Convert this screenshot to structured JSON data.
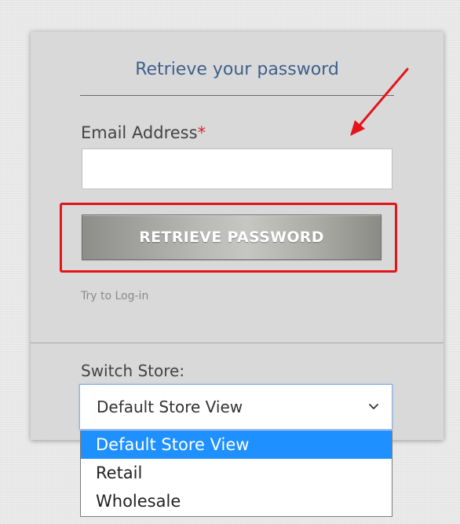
{
  "form": {
    "title": "Retrieve your password",
    "email_label": "Email Address",
    "required_marker": "*",
    "email_value": "",
    "submit_label": "RETRIEVE PASSWORD",
    "login_link": "Try to Log-in"
  },
  "store_switcher": {
    "label": "Switch Store:",
    "selected": "Default Store View",
    "options": [
      "Default Store View",
      "Retail",
      "Wholesale"
    ]
  },
  "colors": {
    "title": "#3f5f8c",
    "highlight": "#e3151a",
    "required": "#d9262c",
    "option_selected": "#1e90ff"
  },
  "icons": {
    "annotation": "red-arrow-icon",
    "select_toggle": "chevron-down-icon"
  }
}
